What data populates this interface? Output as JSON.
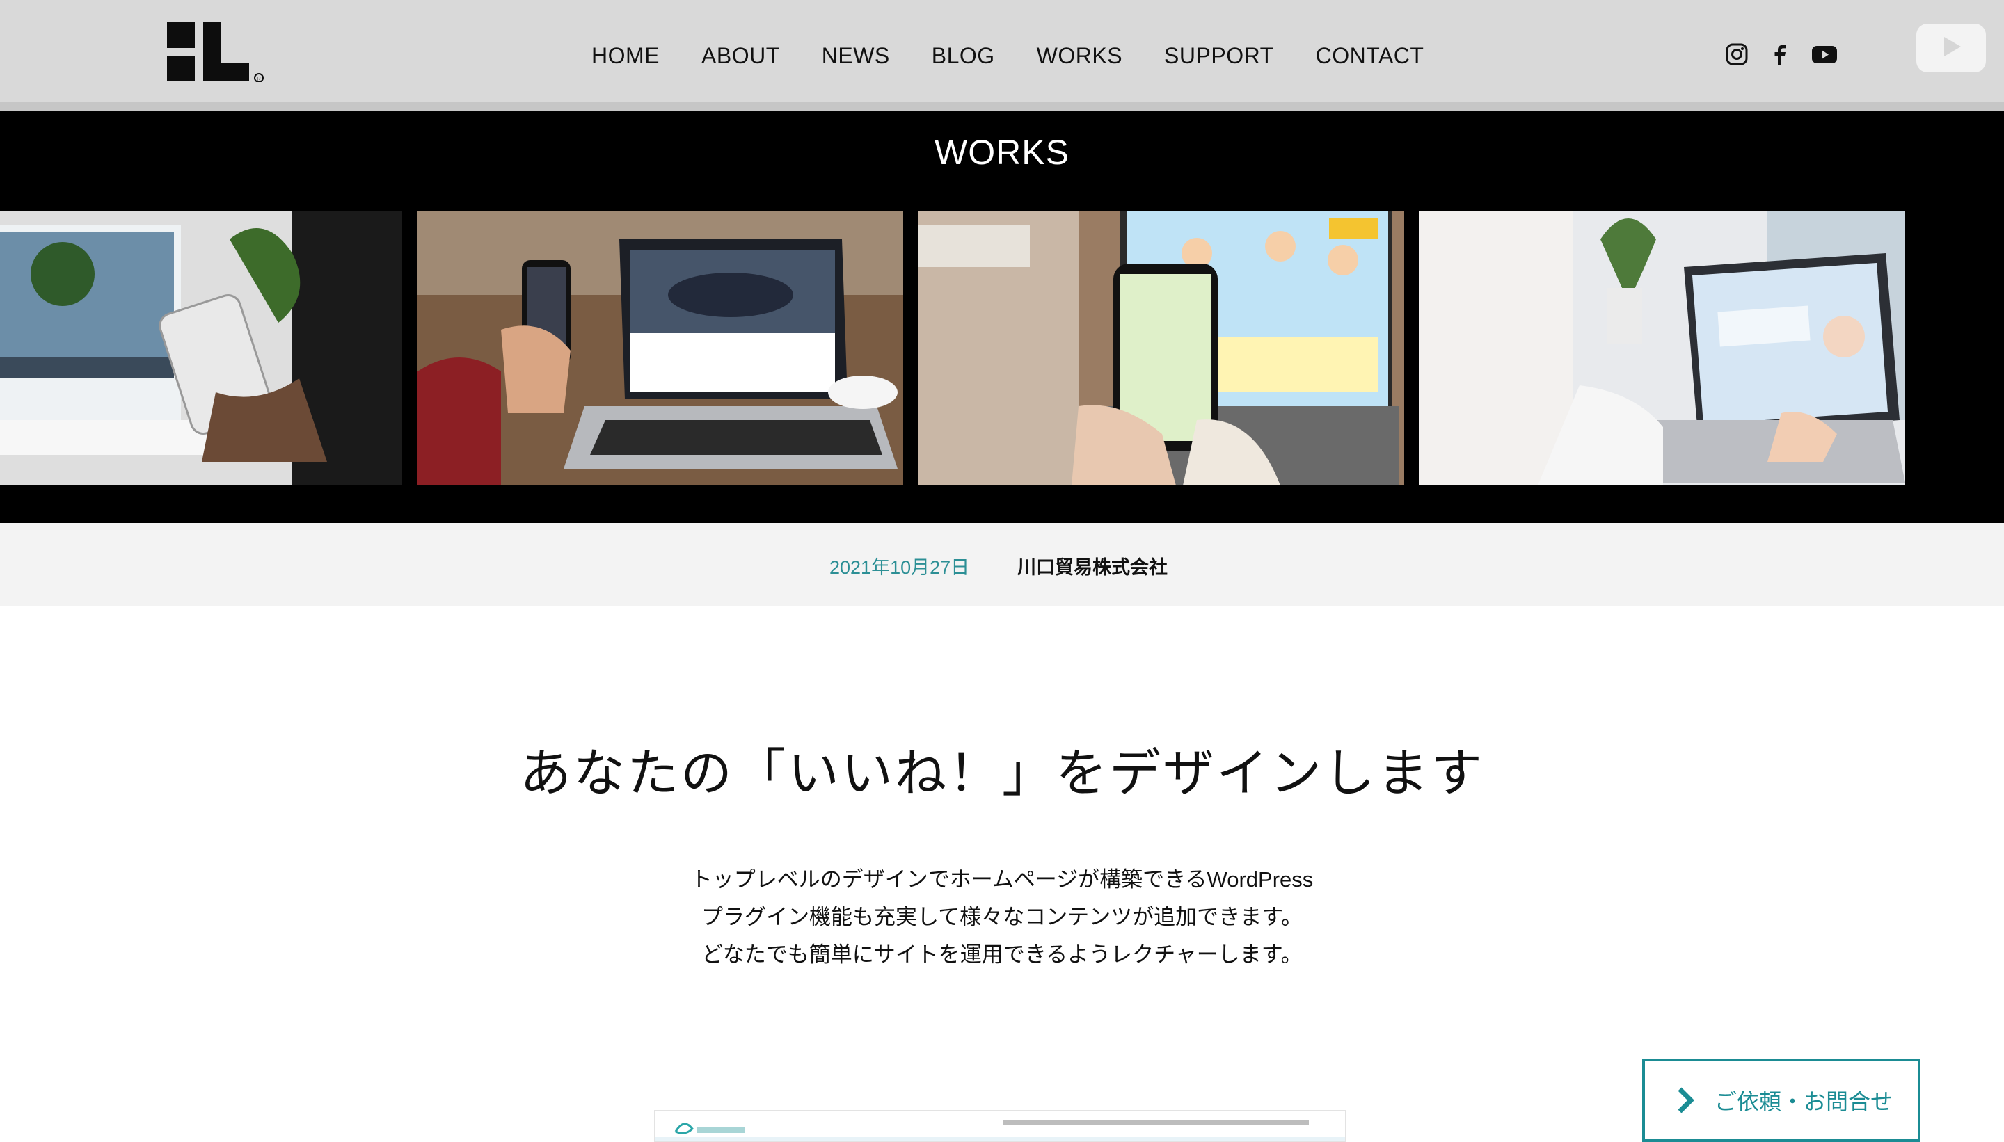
{
  "header": {
    "logo_text": "L",
    "nav": [
      {
        "label": "HOME"
      },
      {
        "label": "ABOUT"
      },
      {
        "label": "NEWS"
      },
      {
        "label": "BLOG"
      },
      {
        "label": "WORKS"
      },
      {
        "label": "SUPPORT"
      },
      {
        "label": "CONTACT"
      }
    ],
    "social_icons": [
      "instagram-icon",
      "facebook-icon",
      "youtube-icon"
    ]
  },
  "hero": {
    "title": "WORKS",
    "slides": [
      "laptop-and-phone-forest-site",
      "laptop-and-phone-car-site",
      "laptop-and-phone-nursery-site",
      "laptop-medical-site"
    ]
  },
  "meta": {
    "date": "2021年10月27日",
    "company": "川口貿易株式会社"
  },
  "main": {
    "headline": "あなたの「いいね！」をデザインします",
    "paragraph": [
      "トップレベルのデザインでホームページが構築できるWordPress",
      "プラグイン機能も充実して様々なコンテンツが追加できます。",
      "どなたでも簡単にサイトを運用できるようレクチャーします。"
    ]
  },
  "contact_button": {
    "label": "ご依頼・お問合せ"
  },
  "colors": {
    "accent": "#1b8c94",
    "date": "#2c8f95",
    "header_bg": "#d9d9d9",
    "hero_bg": "#000000"
  }
}
